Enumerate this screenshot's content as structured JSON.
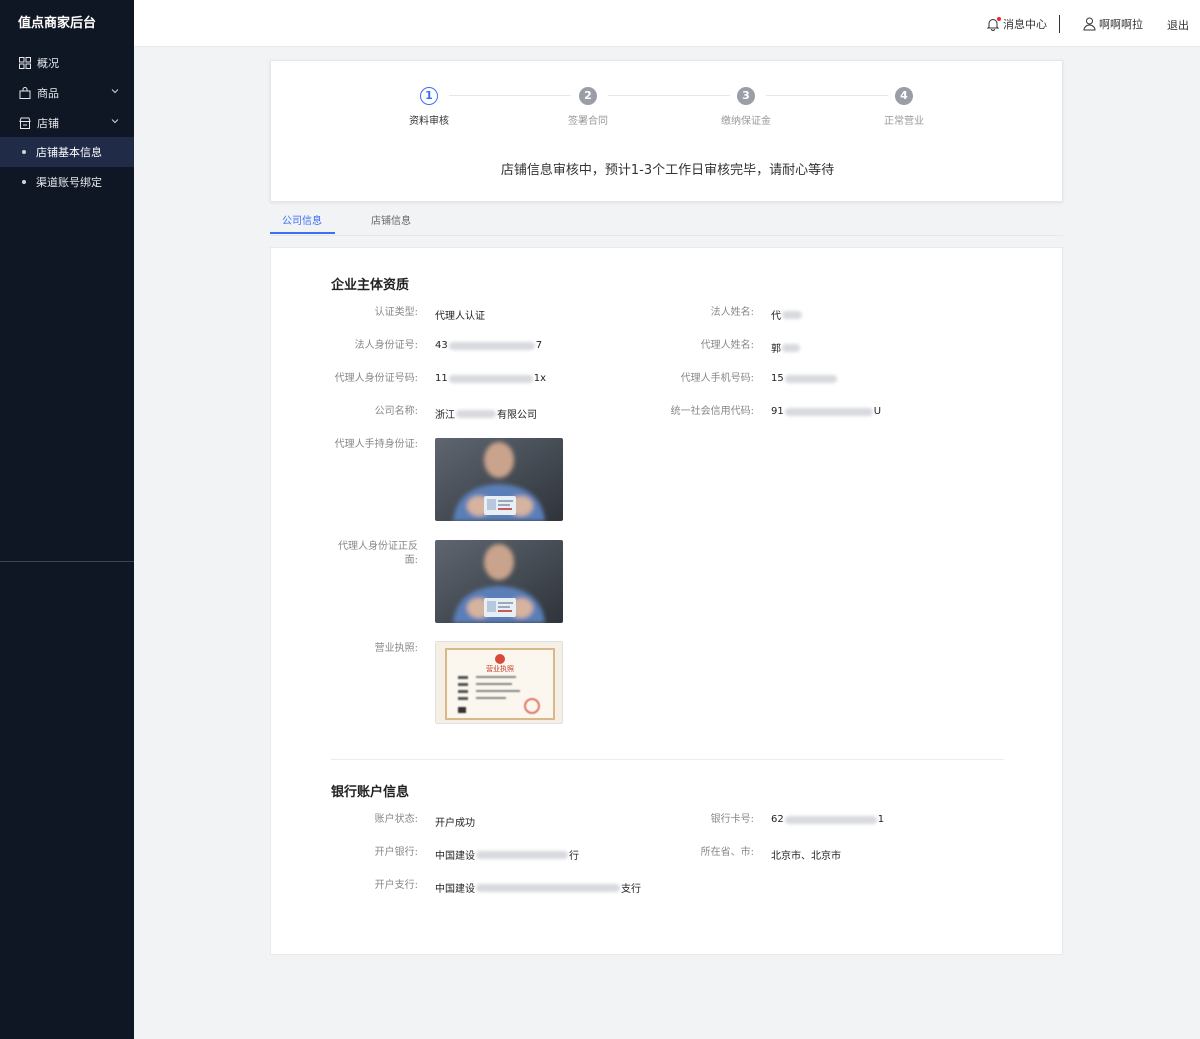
{
  "sidebar": {
    "brand": "值点商家后台",
    "items": [
      {
        "label": "概况",
        "icon": "grid-icon"
      },
      {
        "label": "商品",
        "icon": "bag-icon"
      },
      {
        "label": "店铺",
        "icon": "store-icon"
      },
      {
        "label": "店铺基本信息"
      },
      {
        "label": "渠道账号绑定"
      }
    ]
  },
  "header": {
    "messages": "消息中心",
    "username": "啊啊啊拉",
    "logout": "退出"
  },
  "steps": {
    "items": [
      {
        "num": "1",
        "label": "资料审核"
      },
      {
        "num": "2",
        "label": "签署合同"
      },
      {
        "num": "3",
        "label": "缴纳保证金"
      },
      {
        "num": "4",
        "label": "正常营业"
      }
    ],
    "current": 1,
    "notice": "店铺信息审核中，预计1-3个工作日审核完毕，请耐心等待"
  },
  "tabs": {
    "company": "公司信息",
    "store": "店铺信息"
  },
  "company": {
    "title": "企业主体资质",
    "fields": {
      "cert_type_label": "认证类型:",
      "cert_type_value": "代理人认证",
      "legal_name_label": "法人姓名:",
      "legal_name_prefix": "代",
      "legal_id_label": "法人身份证号:",
      "legal_id_prefix": "43",
      "legal_id_suffix": "7",
      "agent_name_label": "代理人姓名:",
      "agent_name_prefix": "郭",
      "agent_id_label": "代理人身份证号码:",
      "agent_id_prefix": "11",
      "agent_id_suffix": "1x",
      "agent_phone_label": "代理人手机号码:",
      "agent_phone_prefix": "15",
      "company_name_label": "公司名称:",
      "company_name_prefix": "浙江",
      "company_name_suffix": "有限公司",
      "credit_code_label": "统一社会信用代码:",
      "credit_code_prefix": "91",
      "credit_code_suffix": "U",
      "handheld_id_label": "代理人手持身份证:",
      "id_both_sides_label_1": "代理人身份证正反",
      "id_both_sides_label_2": "面:",
      "license_label": "营业执照:",
      "license_heading": "营业执照"
    }
  },
  "bank": {
    "title": "银行账户信息",
    "fields": {
      "status_label": "账户状态:",
      "status_value": "开户成功",
      "card_label": "银行卡号:",
      "card_prefix": "62",
      "card_suffix": "1",
      "bank_label": "开户银行:",
      "bank_prefix": "中国建设",
      "bank_suffix": "行",
      "region_label": "所在省、市:",
      "region_value": "北京市、北京市",
      "branch_label": "开户支行:",
      "branch_prefix": "中国建设",
      "branch_suffix": "支行"
    }
  },
  "colors": {
    "sidebar_bg": "#0f1624",
    "sidebar_active": "#1f2b47",
    "accent": "#3a6ff7",
    "page_bg": "#f2f3f5"
  }
}
